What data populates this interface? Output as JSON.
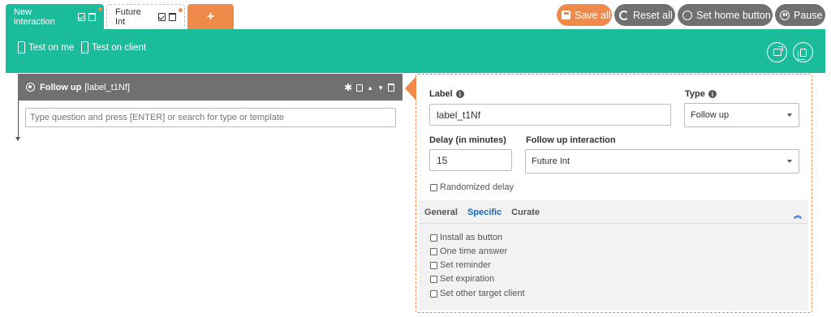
{
  "tabs": [
    {
      "label": "New interaction"
    },
    {
      "label": "Future Int"
    }
  ],
  "add_tab_label": "+",
  "toolbar": {
    "save_all": "Save all",
    "reset_all": "Reset all",
    "set_home": "Set home button",
    "pause": "Pause"
  },
  "greenbar": {
    "test_on_me": "Test on me",
    "test_on_client": "Test on client"
  },
  "node": {
    "title": "Follow up",
    "label": "[label_t1Nf]"
  },
  "search": {
    "placeholder": "Type question and press [ENTER] or search for type or template"
  },
  "detail": {
    "label_title": "Label",
    "label_value": "label_t1Nf",
    "type_title": "Type",
    "type_value": "Follow up",
    "delay_title": "Delay (in minutes)",
    "delay_value": "15",
    "followup_title": "Follow up interaction",
    "followup_value": "Future Int",
    "randomized": "Randomized delay"
  },
  "subtabs": [
    "General",
    "Specific",
    "Curate"
  ],
  "options": [
    "Install as button",
    "One time answer",
    "Set reminder",
    "Set expiration",
    "Set other target client"
  ],
  "colors": {
    "accent": "#1abc9c",
    "orange": "#f08a4b",
    "grey": "#707070",
    "link": "#1565c0"
  }
}
